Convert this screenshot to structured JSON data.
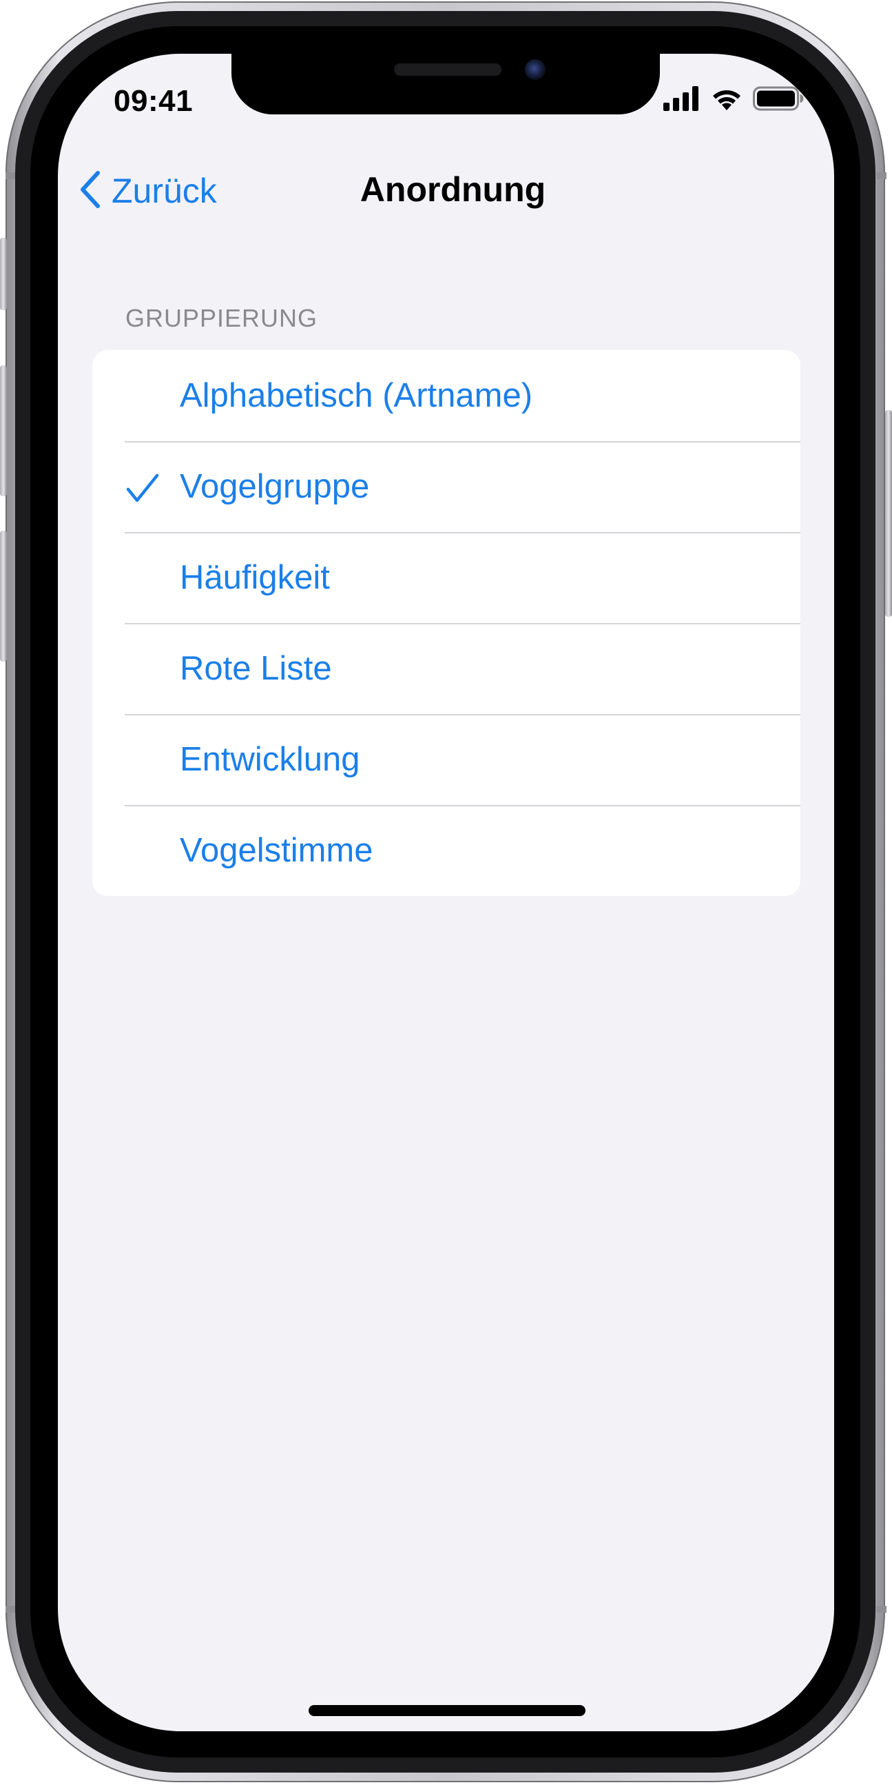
{
  "status_bar": {
    "time": "09:41",
    "icons": [
      "cellular-signal-icon",
      "wifi-icon",
      "battery-icon"
    ]
  },
  "nav": {
    "back_label": "Zurück",
    "title": "Anordnung"
  },
  "section": {
    "header": "GRUPPIERUNG",
    "items": [
      {
        "label": "Alphabetisch (Artname)",
        "selected": false
      },
      {
        "label": "Vogelgruppe",
        "selected": true
      },
      {
        "label": "Häufigkeit",
        "selected": false
      },
      {
        "label": "Rote Liste",
        "selected": false
      },
      {
        "label": "Entwicklung",
        "selected": false
      },
      {
        "label": "Vogelstimme",
        "selected": false
      }
    ]
  },
  "colors": {
    "accent": "#1b7fe8",
    "background": "#f2f2f7",
    "cell": "#ffffff",
    "secondary_text": "#8a8a8e"
  }
}
